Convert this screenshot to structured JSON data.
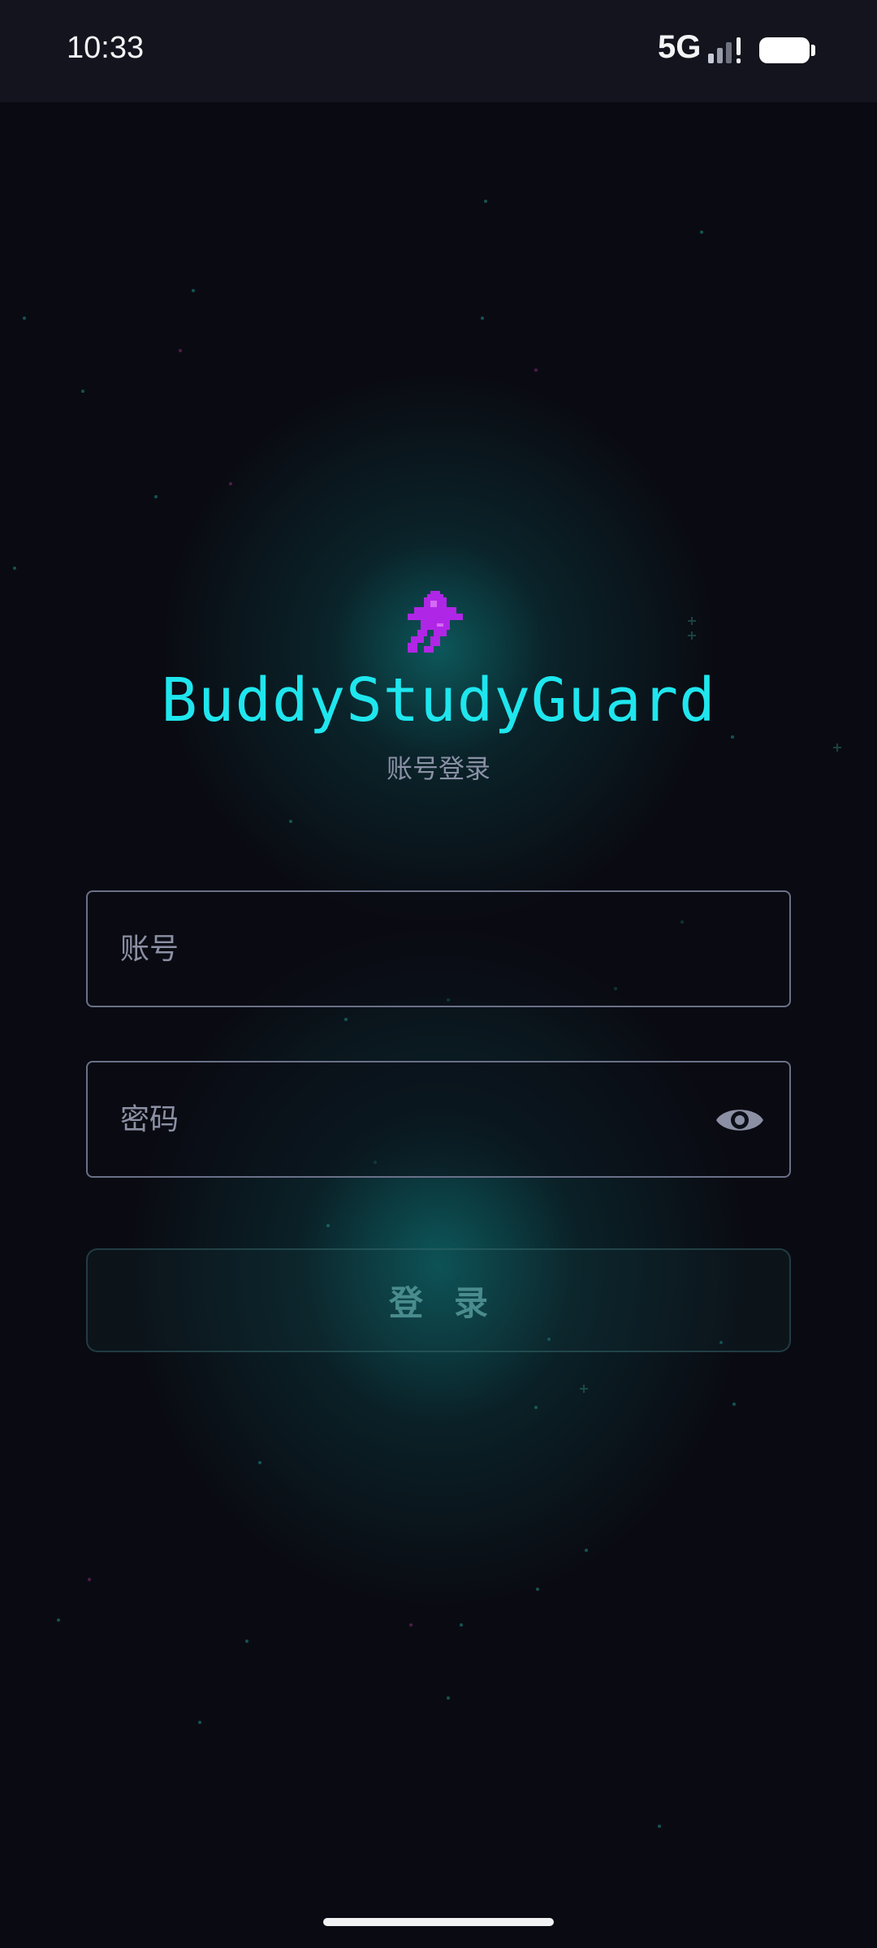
{
  "status_bar": {
    "time": "10:33",
    "network": "5G",
    "signal_icon": "signal-bars-icon",
    "battery_icon": "battery-icon"
  },
  "app": {
    "logo_icon": "pixel-rocket-icon",
    "title": "BuddyStudyGuard",
    "subtitle": "账号登录"
  },
  "form": {
    "account": {
      "placeholder": "账号",
      "value": ""
    },
    "password": {
      "placeholder": "密码",
      "value": "",
      "toggle_icon": "eye-icon"
    },
    "login_label": "登录"
  },
  "colors": {
    "title": "#1fe6ee",
    "logo": "#b026e6",
    "background": "#0a0b12",
    "glow": "#0e9696"
  }
}
